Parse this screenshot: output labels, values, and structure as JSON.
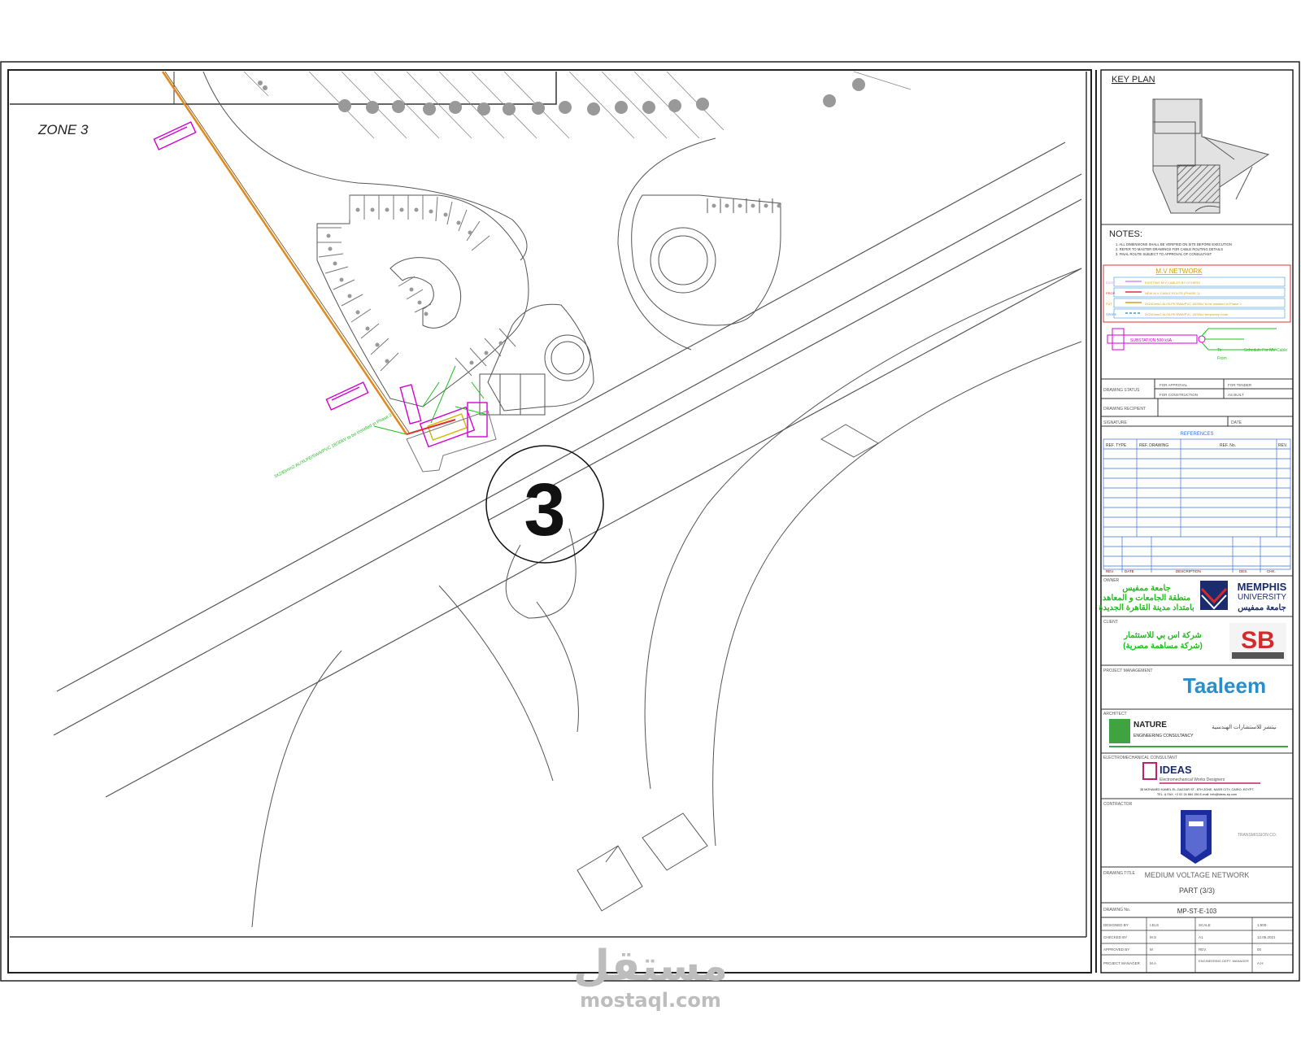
{
  "zone_label": "ZONE 3",
  "zone_number": "3",
  "key_plan": {
    "title": "KEY PLAN"
  },
  "notes": {
    "title": "NOTES:",
    "items": [
      "1. ALL DIMENSIONS SHALL BE VERIFIED ON SITE BEFORE EXECUTION",
      "2. REFER TO MASTER DRAWINGS FOR CABLE ROUTING DETAILS",
      "3. FINAL ROUTE SUBJECT TO APPROVAL OF CONSULTANT"
    ]
  },
  "legend": {
    "title": "M.V NETWORK",
    "rows": [
      {
        "code": "EXIST.",
        "desc": "EXISTING M.V CABLES BY OTHERS",
        "color": "#d38cff"
      },
      {
        "code": "PROP.",
        "desc": "NEW M.V CABLE ROUTE (PHASE 1)",
        "color": "#e03030"
      },
      {
        "code": "FUT.",
        "desc": "3X240mm2 AL/XLPE/SWA/PVC 18/30kV to be installed in Phase 2",
        "color": "#d4a017"
      },
      {
        "code": "SPARE",
        "desc": "3X240mm2 AL/XLPE/SWA/PVC 18/30kV temporary route",
        "color": "#3a9ad9"
      }
    ],
    "substation_label": "SUBSTATION 500 kVA",
    "to_label": "To",
    "from_label": "From",
    "schedule_label": "Schedule For MV Cable"
  },
  "title_block": {
    "drawing_status": "DRAWING STATUS",
    "for_approval": "FOR APPROVAL",
    "for_construction": "FOR CONSTRUCTION",
    "for_tender": "FOR TENDER",
    "as_built": "AS BUILT",
    "drawing_recipient": "DRAWING RECIPIENT",
    "signature": "SIGNATURE",
    "date": "DATE",
    "references": "REFERENCES",
    "ref_headers": [
      "REF. TYPE",
      "REF. DRAWING",
      "REF. No.",
      "REV."
    ],
    "rev_headers": [
      "REV.",
      "DATE",
      "DESCRIPTION",
      "DES.",
      "CHK."
    ],
    "owner_label": "OWNER",
    "owner_ar_line1": "جامعة ممفيس",
    "owner_ar_line2": "منطقة الجامعات و المعاهد",
    "owner_ar_line3": "بامتداد مدينة القاهرة الجديدة",
    "memphis_line1": "MEMPHIS",
    "memphis_line2": "UNIVERSITY",
    "memphis_ar": "جامعة ممفيس",
    "client_label": "CLIENT",
    "sb_ar_line1": "شركة اس بي للاستثمار",
    "sb_ar_line2": "(شركة مساهمة مصرية)",
    "sb_logo": "SB",
    "pm_label": "PROJECT MANAGEMENT",
    "taaleem": "Taaleem",
    "architect_label": "ARCHITECT",
    "nature_line1": "NATURE",
    "nature_line2": "ENGINEERING CONSULTANCY",
    "nature_ar": "نيتشر للاستشارات الهندسية",
    "mep_label": "ELECTROMECHANICAL CONSULTANT",
    "ideas_line1": "IDEAS",
    "ideas_line2": "Electromechanical Works Designers",
    "ideas_address": "38 MOHAMED KAMEL EL-GAZZAR ST., 8TH ZONE, NASR CITY, CAIRO, EGYPT.",
    "ideas_contact": "TEL. & FAX. +2 02 24 884 156   E-mail: info@ideas-ep.com",
    "contractor_label": "CONTRACTOR",
    "contractor_name": "TRANSMISSION CO.",
    "drawing_title_label": "DRAWING TITLE",
    "drawing_title": "MEDIUM VOLTAGE NETWORK",
    "drawing_part": "PART (3/3)",
    "drawing_no_label": "DRAWING No.",
    "drawing_no": "MP-ST-E-103",
    "meta": [
      [
        "DESIGNED BY",
        "I.ELS",
        "SCALE",
        "1:500"
      ],
      [
        "CHECKED BY",
        "M.S",
        "A1",
        "12.05.2021"
      ],
      [
        "APPROVED BY",
        "M",
        "REV.",
        "00"
      ],
      [
        "PROJECT MANAGER",
        "M.A",
        "ENGINEERING DEPT. MANAGER",
        "A.H"
      ]
    ]
  },
  "watermark": {
    "arabic": "مستقل",
    "latin": "mostaql.com"
  },
  "colors": {
    "line": "#555555",
    "magenta": "#d400d4",
    "green": "#1fbf1f",
    "orange": "#e08a1e",
    "blue": "#2a5aa8"
  }
}
